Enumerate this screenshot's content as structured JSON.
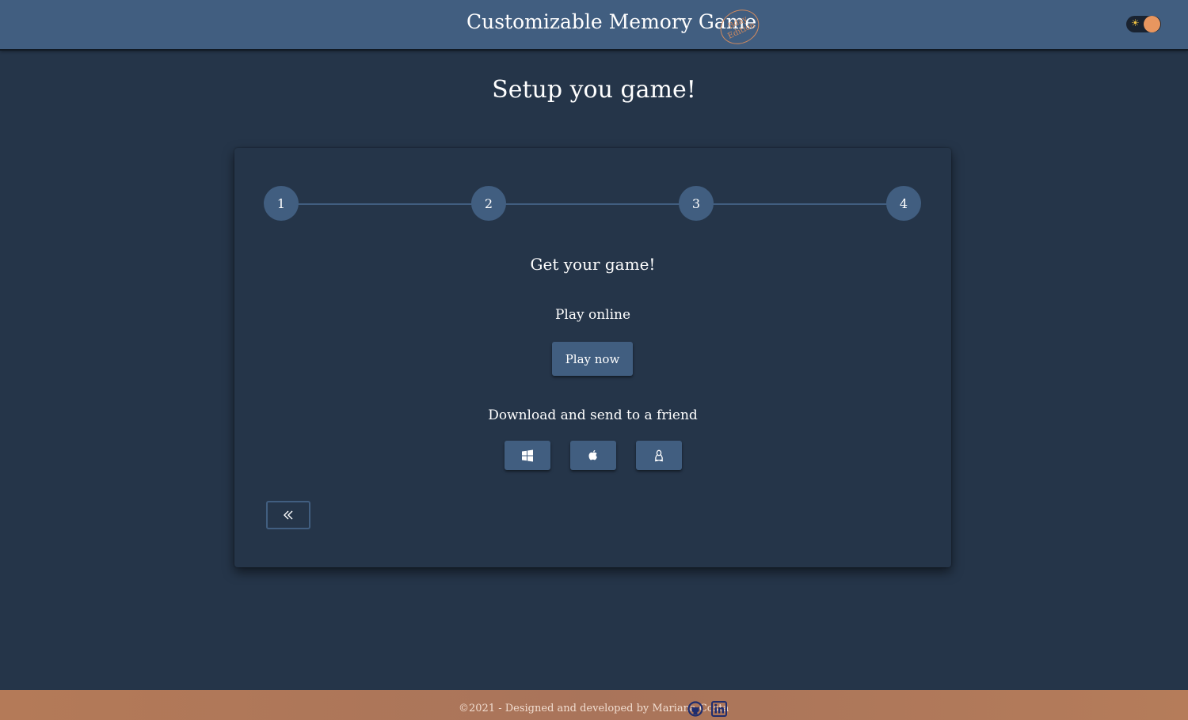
{
  "header": {
    "title": "Customizable Memory Game",
    "badge_line1": "Bday",
    "badge_line2": "Edition",
    "theme_toggle_icon": "sun-icon"
  },
  "page": {
    "title": "Setup you game!"
  },
  "stepper": {
    "steps": [
      "1",
      "2",
      "3",
      "4"
    ]
  },
  "content": {
    "heading": "Get your game!",
    "play_online_label": "Play online",
    "play_now_button": "Play now",
    "download_label": "Download and send to a friend",
    "download_icons": [
      "windows-icon",
      "apple-icon",
      "linux-icon"
    ],
    "back_icon": "double-chevron-left-icon"
  },
  "footer": {
    "text": "©2021 - Designed and developed by Mariana Costa",
    "icons": [
      "github-icon",
      "linkedin-icon"
    ]
  },
  "colors": {
    "background": "#253549",
    "primary": "#415e80",
    "accent": "#e8965f",
    "footer": "#b07857"
  }
}
